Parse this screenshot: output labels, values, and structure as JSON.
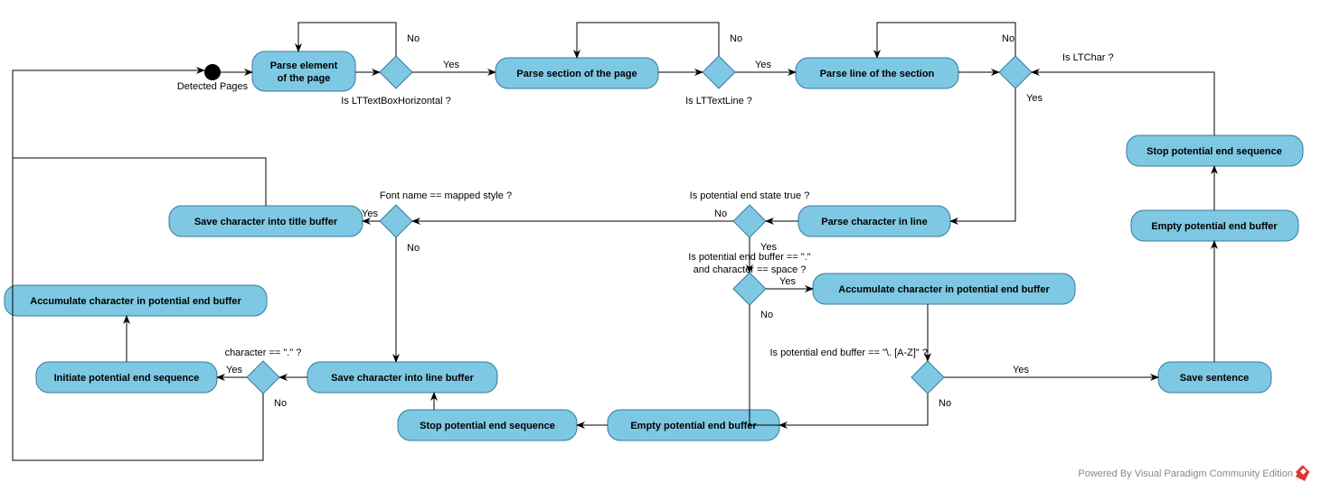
{
  "start_label": "Detected Pages",
  "activities": {
    "parse_element_l1": "Parse element",
    "parse_element_l2": "of the page",
    "parse_section": "Parse section of the page",
    "parse_line": "Parse line of the section",
    "parse_char": "Parse character in line",
    "save_title": "Save character into title buffer",
    "save_line": "Save character into line buffer",
    "initiate_end": "Initiate potential end sequence",
    "accum_left": "Accumulate character in potential end buffer",
    "accum_right": "Accumulate character in potential end buffer",
    "stop_end_lower": "Stop potential end sequence",
    "empty_buf_lower": "Empty potential end buffer",
    "save_sentence": "Save sentence",
    "empty_buf_right": "Empty potential end buffer",
    "stop_end_right": "Stop potential end sequence"
  },
  "decisions": {
    "d1_q": "Is LTTextBoxHorizontal ?",
    "d2_q": "Is LTTextLine ?",
    "d3_q": "Is LTChar ?",
    "d4_q": "Is potential end state true ?",
    "d5_q": "Font name == mapped style ?",
    "d6_q1": "Is potential end buffer == \".\"",
    "d6_q2": "and character == space ?",
    "d7_q": "character == \".\" ?",
    "d8_q": "Is potential end buffer == \"\\. [A-Z]\" ?"
  },
  "labels": {
    "yes": "Yes",
    "no": "No"
  },
  "watermark": "Powered By Visual Paradigm Community Edition"
}
